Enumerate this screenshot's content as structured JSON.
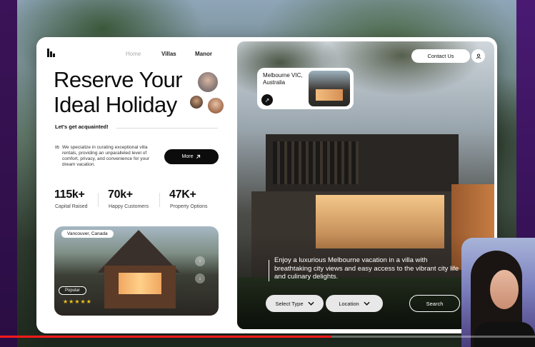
{
  "nav": {
    "home": "Home",
    "villas": "Villas",
    "manor": "Manor"
  },
  "hero_title_line1": "Reserve Your",
  "hero_title_line2": "Ideal Holiday",
  "acquainted": "Let's get acquainted!",
  "intro_number": "05",
  "intro_text": "We specialize in curating exceptional villa rentals, providing an unparalleled level of comfort, privacy, and convenience for your dream vacation.",
  "more_label": "More",
  "stats": [
    {
      "value": "115k+",
      "label": "Capital Raised"
    },
    {
      "value": "70k+",
      "label": "Happy Customers"
    },
    {
      "value": "47K+",
      "label": "Property Options"
    }
  ],
  "mini_card": {
    "location": "Vancouver, Canada",
    "badge": "Popular",
    "rating_stars": 5
  },
  "contact_label": "Contact Us",
  "location_card": {
    "text": "Melbourne VIC, Australia"
  },
  "hero_description": "Enjoy a luxurious Melbourne vacation in a villa with breathtaking city views and easy access to the vibrant city life and culinary delights.",
  "filters": {
    "type": "Select Type",
    "location": "Location",
    "search": "Search"
  },
  "video_progress": 0.62,
  "icons": [
    "logo-icon",
    "arrow-up-right-icon",
    "user-icon",
    "chevron-down-icon",
    "star-icon",
    "arrow-icon"
  ],
  "colors": {
    "accent": "#0c0c0c",
    "card": "#ffffff",
    "progress": "#ff1a1a"
  }
}
